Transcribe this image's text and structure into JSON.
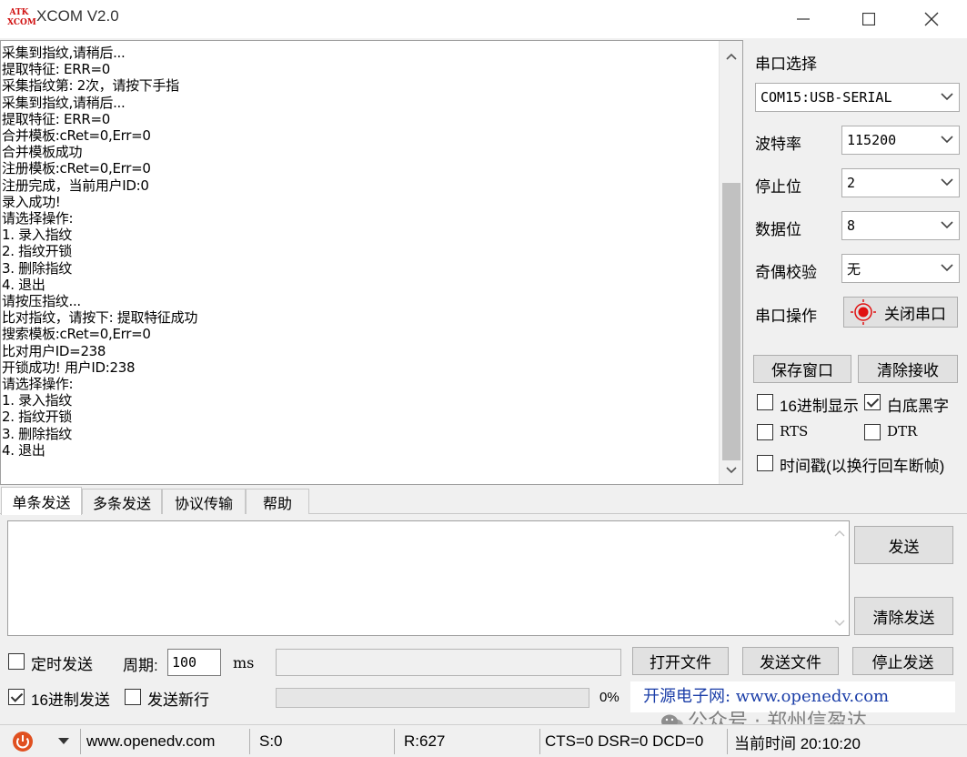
{
  "window": {
    "logo_top": "ATK",
    "logo_bottom": "XCOM",
    "title": "XCOM V2.0",
    "minimize_icon": "minimize-icon",
    "maximize_icon": "maximize-icon",
    "close_icon": "close-icon"
  },
  "receive": {
    "lines": [
      "采集到指纹,请稍后...",
      "提取特征: ERR=0",
      "采集指纹第: 2次，请按下手指",
      "采集到指纹,请稍后...",
      "提取特征: ERR=0",
      "合并模板:cRet=0,Err=0",
      "合并模板成功",
      "注册模板:cRet=0,Err=0",
      "注册完成，当前用户ID:0",
      "录入成功!",
      "请选择操作:",
      "1. 录入指纹",
      "2. 指纹开锁",
      "3. 删除指纹",
      "4. 退出",
      "请按压指纹...",
      "比对指纹，请按下: 提取特征成功",
      "搜索模板:cRet=0,Err=0",
      "比对用户ID=238",
      "开锁成功! 用户ID:238",
      "请选择操作:",
      "1. 录入指纹",
      "2. 指纹开锁",
      "3. 删除指纹",
      "4. 退出"
    ],
    "scroll_position": 0.38
  },
  "side": {
    "port_select_label": "串口选择",
    "port_value": "COM15:USB-SERIAL",
    "baud_label": "波特率",
    "baud_value": "115200",
    "stopbits_label": "停止位",
    "stopbits_value": "2",
    "databits_label": "数据位",
    "databits_value": "8",
    "parity_label": "奇偶校验",
    "parity_value": "无",
    "port_op_label": "串口操作",
    "close_port_label": "关闭串口",
    "save_window_label": "保存窗口",
    "clear_recv_label": "清除接收",
    "hex_display_label": "16进制显示",
    "hex_display_checked": false,
    "white_black_label": "白底黑字",
    "white_black_checked": true,
    "rts_label": "RTS",
    "rts_checked": false,
    "dtr_label": "DTR",
    "dtr_checked": false,
    "timestamp_label": "时间戳(以换行回车断帧)",
    "timestamp_checked": false,
    "status_color": "#e01010"
  },
  "tabs": [
    {
      "label": "单条发送",
      "active": true
    },
    {
      "label": "多条发送",
      "active": false
    },
    {
      "label": "协议传输",
      "active": false
    },
    {
      "label": "帮助",
      "active": false
    }
  ],
  "send": {
    "text": "",
    "send_label": "发送",
    "clear_send_label": "清除发送",
    "timed_send_label": "定时发送",
    "timed_send_checked": false,
    "period_label": "周期:",
    "period_value": "100",
    "period_unit": "ms",
    "open_file_label": "打开文件",
    "send_file_label": "发送文件",
    "stop_send_label": "停止发送",
    "hex_send_label": "16进制发送",
    "hex_send_checked": true,
    "newline_label": "发送新行",
    "newline_checked": false,
    "progress_text": "0%",
    "progress": 0,
    "ad_text": "开源电子网: www.openedv.com",
    "watermark": "公众号 · 郑州信盈达"
  },
  "statusbar": {
    "url": "www.openedv.com",
    "sent": "S:0",
    "received": "R:627",
    "lines_state": "CTS=0 DSR=0 DCD=0",
    "time": "当前时间 20:10:20"
  }
}
